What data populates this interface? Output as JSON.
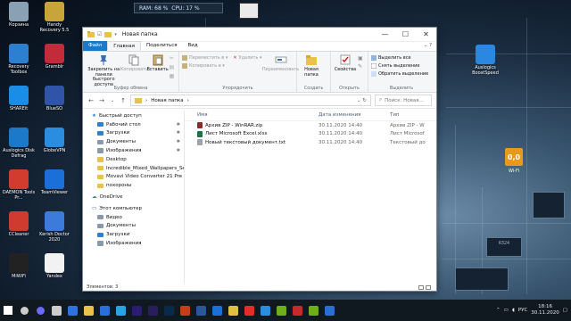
{
  "desktop": {
    "icons_left": [
      {
        "label": "Корзина",
        "color": "#8aa0b3",
        "glyph": "recycle-bin-icon"
      },
      {
        "label": "Handy Recovery 5.5",
        "color": "#c9a43a",
        "glyph": "handy-recovery-icon"
      },
      {
        "label": "Recovery Toolbox",
        "color": "#2d7fd0",
        "glyph": "recovery-toolbox-icon"
      },
      {
        "label": "Gramblr",
        "color": "#c22b3a",
        "glyph": "gramblr-icon"
      },
      {
        "label": "SHAREit",
        "color": "#1a8de6",
        "glyph": "shareit-icon"
      },
      {
        "label": "BlueSO",
        "color": "#3055a8",
        "glyph": "blueso-icon"
      },
      {
        "label": "Auslogics Disk Defrag",
        "color": "#1c78c9",
        "glyph": "disk-defrag-icon"
      },
      {
        "label": "GlobeVPN",
        "color": "#2a8de0",
        "glyph": "globevpn-icon"
      },
      {
        "label": "DAEMON Tools Pr...",
        "color": "#d23c2e",
        "glyph": "daemon-tools-icon"
      },
      {
        "label": "TeamViewer",
        "color": "#1a6fd8",
        "glyph": "teamviewer-icon"
      },
      {
        "label": "CCleaner",
        "color": "#cf3b2f",
        "glyph": "ccleaner-icon"
      },
      {
        "label": "Kerish Doctor 2020",
        "color": "#3c7bd9",
        "glyph": "kerish-doctor-icon"
      },
      {
        "label": "MiWiFi",
        "color": "#222222",
        "glyph": "miwifi-icon"
      },
      {
        "label": "Yandex",
        "color": "#f2f2f2",
        "glyph": "yandex-icon"
      }
    ],
    "icons_right": [
      {
        "label": "Auslogics BoostSpeed",
        "color": "#2a88e0",
        "glyph": "boostspeed-icon"
      }
    ],
    "widget": {
      "ram": "RAM: 68 %",
      "cpu": "CPU: 17 %"
    },
    "gauge": {
      "value": "0,0",
      "label": "Wi-Fi"
    },
    "chip_text": "R324"
  },
  "window": {
    "title": "Новая папка",
    "controls": {
      "minimize": "—",
      "maximize": "☐",
      "close": "✕"
    },
    "tabs": {
      "file": "Файл",
      "home": "Главная",
      "share": "Поделиться",
      "view": "Вид"
    },
    "ribbon": {
      "clipboard": {
        "pin": "Закрепить на панели быстрого доступа",
        "copy": "Копировать",
        "paste": "Вставить",
        "group": "Буфер обмена"
      },
      "organize": {
        "move_to": "Переместить в ▾",
        "copy_to": "Копировать в ▾",
        "delete": "Удалить ▾",
        "rename": "Переименовать",
        "group": "Упорядочить"
      },
      "new": {
        "new_folder": "Новая папка",
        "group": "Создать"
      },
      "open": {
        "properties": "Свойства",
        "group": "Открыть"
      },
      "select": {
        "select_all": "Выделить все",
        "select_none": "Снять выделение",
        "invert": "Обратить выделение",
        "group": "Выделить"
      }
    },
    "address": {
      "path": "Новая папка",
      "search_placeholder": "Поиск: Новая..."
    },
    "nav": {
      "quick_access": "Быстрый доступ",
      "items": [
        {
          "label": "Рабочий стол",
          "pinned": true,
          "color": "#2d7fd0"
        },
        {
          "label": "Загрузки",
          "pinned": true,
          "color": "#2d7fd0"
        },
        {
          "label": "Документы",
          "pinned": true,
          "color": "#8a9aa8"
        },
        {
          "label": "Изображения",
          "pinned": true,
          "color": "#8a9aa8"
        },
        {
          "label": "Desktop",
          "pinned": false,
          "color": "#e8c24a"
        },
        {
          "label": "Incredible_Mixed_Wallpapers_Se",
          "pinned": false,
          "color": "#e8c24a"
        },
        {
          "label": "Movavi Video Converter 21 Pre",
          "pinned": false,
          "color": "#e8c24a"
        },
        {
          "label": "похороны",
          "pinned": false,
          "color": "#e8c24a"
        }
      ],
      "onedrive": "OneDrive",
      "this_pc": "Этот компьютер",
      "pc_items": [
        {
          "label": "Видео",
          "color": "#8a9aa8"
        },
        {
          "label": "Документы",
          "color": "#8a9aa8"
        },
        {
          "label": "Загрузки",
          "color": "#2d7fd0"
        },
        {
          "label": "Изображения",
          "color": "#8a9aa8"
        }
      ]
    },
    "columns": {
      "name": "Имя",
      "date": "Дата изменения",
      "type": "Тип"
    },
    "files": [
      {
        "name": "Архив ZIP - WinRAR.zip",
        "date": "30.11.2020 14:40",
        "type": "Архив ZIP - W",
        "color": "#8b2a2a"
      },
      {
        "name": "Лист Microsoft Excel.xlsx",
        "date": "30.11.2020 14:40",
        "type": "Лист Microsof",
        "color": "#1f7244"
      },
      {
        "name": "Новый текстовый документ.txt",
        "date": "30.11.2020 14:40",
        "type": "Текстовый до",
        "color": "#9aa4ae"
      }
    ],
    "status": "Элементов: 3"
  },
  "taskbar": {
    "apps": [
      {
        "name": "start",
        "color": "#ffffff"
      },
      {
        "name": "search",
        "color": "#cccccc"
      },
      {
        "name": "cortana",
        "color": "#6a6afc"
      },
      {
        "name": "task-view",
        "color": "#cccccc"
      },
      {
        "name": "media",
        "color": "#3070e0"
      },
      {
        "name": "explorer",
        "color": "#e8c24a"
      },
      {
        "name": "app-blue",
        "color": "#2a6fd8"
      },
      {
        "name": "telegram",
        "color": "#2aa3e0"
      },
      {
        "name": "after-effects",
        "color": "#2c1e6e"
      },
      {
        "name": "premiere",
        "color": "#2a1d5c"
      },
      {
        "name": "photoshop",
        "color": "#0a2a4a"
      },
      {
        "name": "powerpoint",
        "color": "#c43e1c"
      },
      {
        "name": "word",
        "color": "#2b579a"
      },
      {
        "name": "wifi-tool",
        "color": "#1a6fd8"
      },
      {
        "name": "chrome",
        "color": "#e0c040"
      },
      {
        "name": "yandex",
        "color": "#e82a2a"
      },
      {
        "name": "edge",
        "color": "#2a8de0"
      },
      {
        "name": "nvidia",
        "color": "#6fb01a"
      },
      {
        "name": "acrobat",
        "color": "#c82a2a"
      },
      {
        "name": "torrent",
        "color": "#6fb01a"
      },
      {
        "name": "vpn",
        "color": "#2a6fd8"
      }
    ],
    "lang": "РУС",
    "time": "18:16",
    "date": "30.11.2020"
  }
}
